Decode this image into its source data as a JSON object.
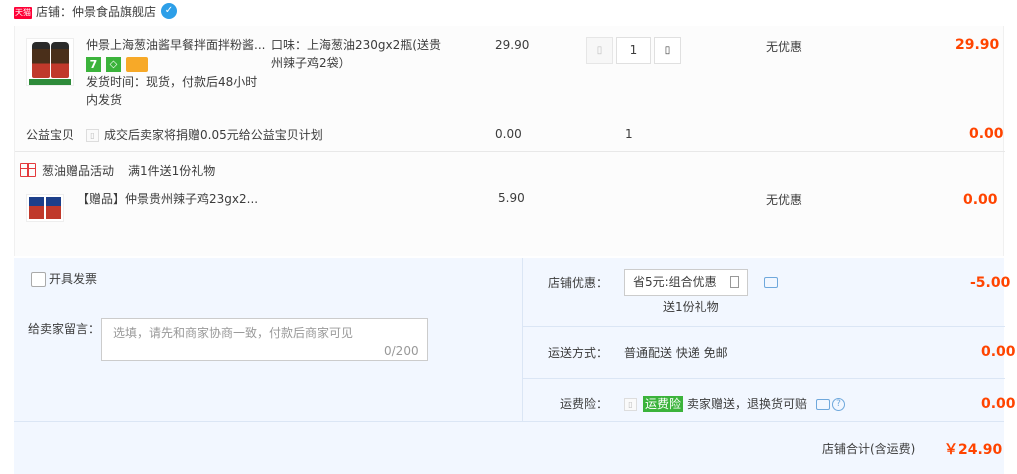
{
  "shop": {
    "tmall_label": "天猫",
    "name": "店铺：仲景食品旗舰店"
  },
  "main_item": {
    "title": "仲景上海葱油酱早餐拌面拌粉酱...",
    "thumb_caption": "上海葱油230gx2瓶",
    "sku": "口味：上海葱油230gx2瓶(送贵州辣子鸡2袋）",
    "delivery": "发货时间：现货，付款后48小时内发货",
    "unit_price": "29.90",
    "quantity": "1",
    "discount": "无优惠",
    "subtotal": "29.90"
  },
  "charity": {
    "label": "公益宝贝",
    "text": "成交后卖家将捐赠0.05元给公益宝贝计划",
    "price": "0.00",
    "quantity": "1",
    "subtotal": "0.00"
  },
  "gift_promo": {
    "title": "葱油赠品活动",
    "rule": "满1件送1份礼物"
  },
  "gift_item": {
    "title": "【赠品】仲景贵州辣子鸡23gx2...",
    "unit_price": "5.90",
    "discount": "无优惠",
    "subtotal": "0.00"
  },
  "invoice": {
    "label": "开具发票"
  },
  "message": {
    "label": "给卖家留言：",
    "placeholder": "选填，请先和商家协商一致，付款后商家可见",
    "counter": "0/200"
  },
  "shop_discount": {
    "label": "店铺优惠：",
    "selected": "省5元:组合优惠",
    "note": "送1份礼物",
    "amount": "-5.00"
  },
  "shipping": {
    "label": "运送方式：",
    "value": "普通配送 快递 免邮",
    "amount": "0.00"
  },
  "insurance": {
    "label": "运费险：",
    "tag": "运费险",
    "text": "卖家赠送，退换货可赔",
    "amount": "0.00"
  },
  "total": {
    "label": "店铺合计(含运费)",
    "amount": "￥24.90"
  }
}
